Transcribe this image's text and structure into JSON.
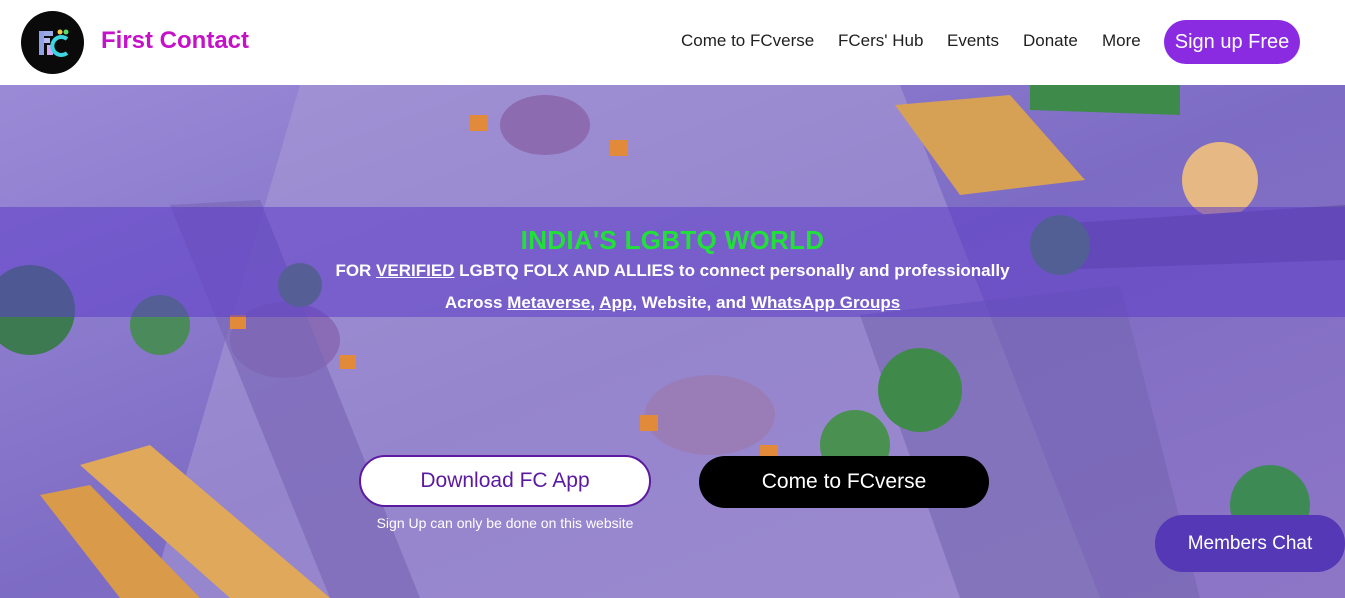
{
  "brand": {
    "name": "First Contact",
    "logo_icon": "fc-logo-icon"
  },
  "nav": {
    "items": [
      "Come to FCverse",
      "FCers' Hub",
      "Events",
      "Donate",
      "More"
    ],
    "signup_label": "Sign up Free"
  },
  "hero": {
    "title": "INDIA'S LGBTQ WORLD",
    "line1": {
      "pre": "FOR ",
      "link": "VERIFIED",
      "post": " LGBTQ FOLX AND ALLIES to connect personally and professionally"
    },
    "line2": {
      "pre": "Across ",
      "link1": "Metaverse",
      "sep1": ", ",
      "link2": "App",
      "mid": ", Website, and ",
      "link3": "WhatsApp Groups"
    },
    "download_label": "Download FC App",
    "fcverse_label": "Come to FCverse",
    "signup_note": "Sign Up can only be done on this website",
    "background_image": "aerial-terrace-cafe-image"
  },
  "chat": {
    "label": "Members Chat"
  },
  "colors": {
    "brand": "#c512c9",
    "accent": "#8a2be2",
    "title_green": "#22e03a",
    "chat_bg": "#5438b5"
  }
}
